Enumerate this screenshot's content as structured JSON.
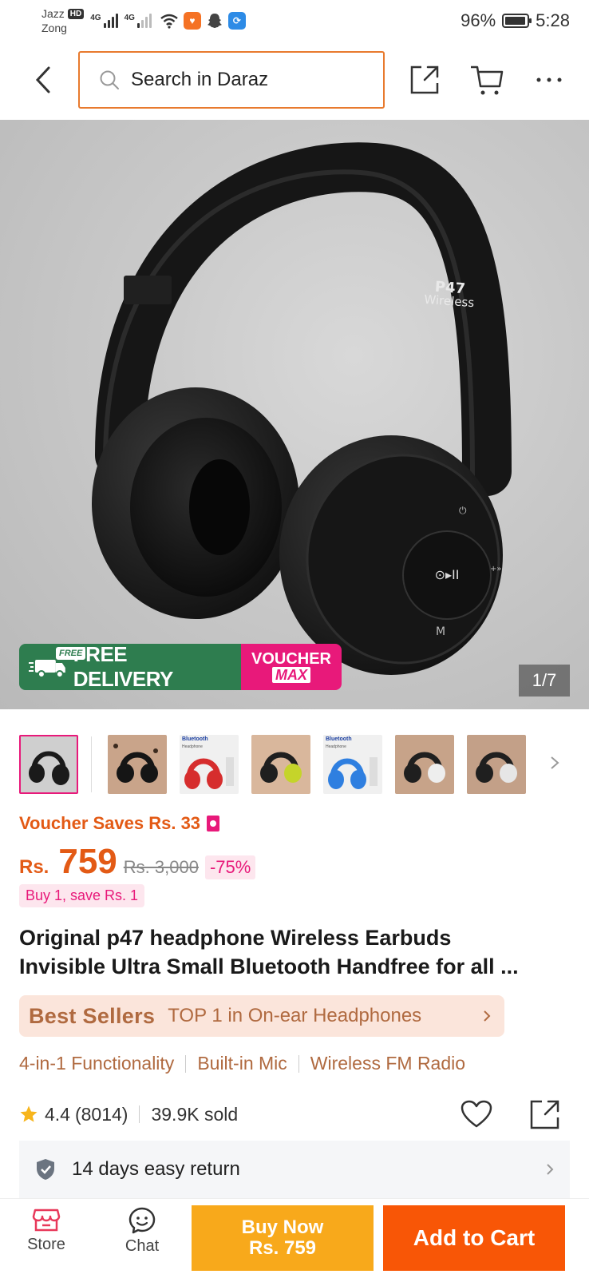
{
  "status_bar": {
    "carrier1": "Jazz",
    "carrier1_badge": "HD",
    "carrier2": "Zong",
    "network_label": "4G",
    "battery": "96%",
    "battery_level": 0.96,
    "time": "5:28"
  },
  "header": {
    "search_placeholder": "Search in Daraz"
  },
  "gallery": {
    "counter": "1/7",
    "model_label_line1": "P47",
    "model_label_line2": "Wireless",
    "delivery_badge": "FREE",
    "delivery_text": "FREE DELIVERY",
    "voucher_line1": "VOUCHER",
    "voucher_line2": "MAX",
    "thumb_label": "Bluetooth",
    "thumb_sublabel": "Headphone"
  },
  "price": {
    "voucher_saves": "Voucher Saves Rs. 33",
    "currency": "Rs.",
    "current": "759",
    "original": "Rs. 3,000",
    "discount": "-75%",
    "buy_save": "Buy 1, save Rs. 1"
  },
  "product": {
    "title_line1": "Original p47 headphone Wireless Earbuds",
    "title_line2": "Invisible Ultra Small Bluetooth Handfree for all ..."
  },
  "best_sellers": {
    "label": "Best Sellers",
    "text": "TOP 1 in On-ear Headphones"
  },
  "features": [
    "4-in-1 Functionality",
    "Built-in Mic",
    "Wireless FM Radio"
  ],
  "rating": {
    "value": "4.4",
    "count": "(8014)",
    "sold": "39.9K sold"
  },
  "return_policy": {
    "text": "14 days easy return"
  },
  "bottom_bar": {
    "store_label": "Store",
    "chat_label": "Chat",
    "buy_now_line1": "Buy Now",
    "buy_now_line2": "Rs. 759",
    "add_to_cart": "Add to Cart"
  },
  "colors": {
    "accent_orange": "#f85606",
    "buy_now_yellow": "#f8a91b",
    "pink": "#e8197a",
    "price_orange": "#e35a15",
    "best_seller_brown": "#b06a40",
    "delivery_green": "#2e7d4f"
  }
}
